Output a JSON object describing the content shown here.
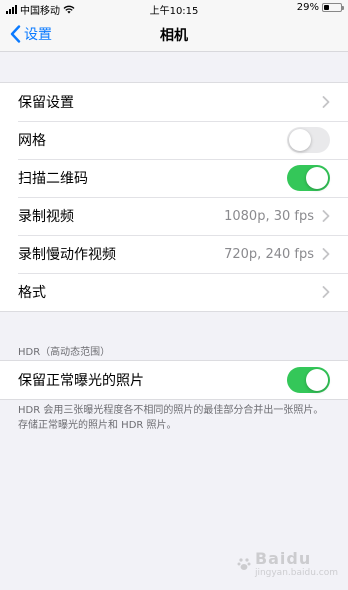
{
  "status_bar": {
    "carrier": "中国移动",
    "time": "上午10:15",
    "battery_percent": "29%",
    "battery_level": 0.29
  },
  "nav": {
    "back_label": "设置",
    "title": "相机"
  },
  "group1": {
    "rows": [
      {
        "label": "保留设置",
        "type": "chevron"
      },
      {
        "label": "网格",
        "type": "toggle",
        "on": false
      },
      {
        "label": "扫描二维码",
        "type": "toggle",
        "on": true
      },
      {
        "label": "录制视频",
        "type": "chevron",
        "value": "1080p, 30 fps"
      },
      {
        "label": "录制慢动作视频",
        "type": "chevron",
        "value": "720p, 240 fps"
      },
      {
        "label": "格式",
        "type": "chevron"
      }
    ]
  },
  "hdr": {
    "section_header": "HDR（高动态范围）",
    "row_label": "保留正常曝光的照片",
    "row_on": true,
    "footer": "HDR 会用三张曝光程度各不相同的照片的最佳部分合并出一张照片。存储正常曝光的照片和 HDR 照片。"
  },
  "watermark": {
    "brand": "Baidu",
    "sub": "jingyan.baidu.com"
  },
  "colors": {
    "accent": "#0a7aff",
    "toggle_on": "#34c759",
    "toggle_off": "#e9e9eb",
    "background": "#f2f2f7"
  }
}
